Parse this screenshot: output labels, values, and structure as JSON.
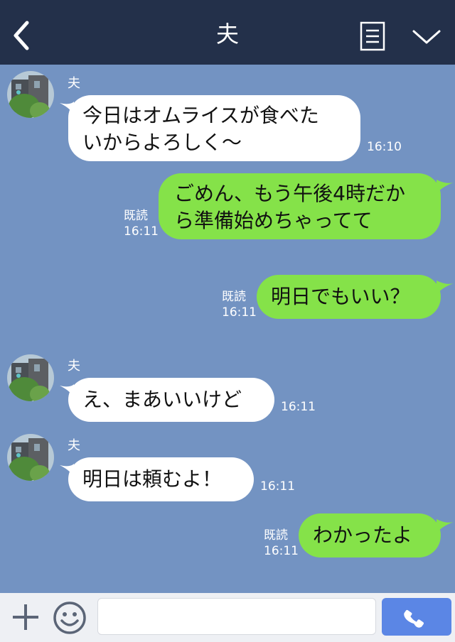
{
  "header": {
    "title": "夫"
  },
  "contact_name": "夫",
  "messages": [
    {
      "side": "in",
      "line1": "今日はオムライスが食べた",
      "line2": "いからよろしく〜",
      "time": "16:10"
    },
    {
      "side": "out",
      "line1": "ごめん、もう午後4時だか",
      "line2": "ら準備始めちゃってて",
      "read": "既読",
      "time": "16:11"
    },
    {
      "side": "out",
      "text": "明日でもいい？",
      "read": "既読",
      "time": "16:11"
    },
    {
      "side": "in",
      "text": "え、まあいいけど",
      "time": "16:11"
    },
    {
      "side": "in",
      "text": "明日は頼むよ！",
      "time": "16:11"
    },
    {
      "side": "out",
      "text": "わかったよ",
      "read": "既読",
      "time": "16:11"
    }
  ],
  "footer": {
    "input_placeholder": ""
  },
  "colors": {
    "header": "#23304a",
    "chat_bg": "#7393c2",
    "sent_bubble": "#85e249",
    "call_button": "#5b86e5"
  },
  "icons": [
    "back-chevron-icon",
    "menu-icon",
    "chevron-down-icon",
    "plus-icon",
    "smiley-icon",
    "phone-icon"
  ]
}
